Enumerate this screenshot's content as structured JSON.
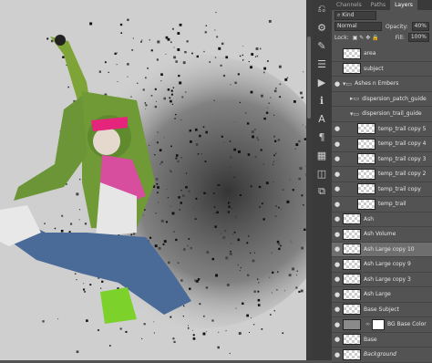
{
  "panel": {
    "tabs": [
      {
        "label": "Channels"
      },
      {
        "label": "Paths"
      },
      {
        "label": "Layers"
      }
    ],
    "filter_value": "Kind",
    "blend_mode": "Normal",
    "opacity_label": "Opacity:",
    "opacity_value": "40%",
    "lock_label": "Lock:",
    "fill_label": "Fill:",
    "fill_value": "100%"
  },
  "layers": [
    {
      "name": "area"
    },
    {
      "name": "subject"
    },
    {
      "name": "Ashes n Embers"
    },
    {
      "name": "dispersion_patch_guide"
    },
    {
      "name": "dispersion_trail_guide"
    },
    {
      "name": "temp_trail copy 5"
    },
    {
      "name": "temp_trail copy 4"
    },
    {
      "name": "temp_trail copy 3"
    },
    {
      "name": "temp_trail copy 2"
    },
    {
      "name": "temp_trail copy"
    },
    {
      "name": "temp_trail"
    },
    {
      "name": "Ash"
    },
    {
      "name": "Ash Volume"
    },
    {
      "name": "Ash Large copy 10"
    },
    {
      "name": "Ash Large copy 9"
    },
    {
      "name": "Ash Large copy 3"
    },
    {
      "name": "Ash Large"
    },
    {
      "name": "Base Subject"
    },
    {
      "name": "BG Base Color"
    },
    {
      "name": "Base"
    },
    {
      "name": "Background"
    }
  ],
  "colors": {
    "selection": "#6e6e6e",
    "panel_bg": "#535353",
    "canvas_bg": "#cfcfcf"
  }
}
